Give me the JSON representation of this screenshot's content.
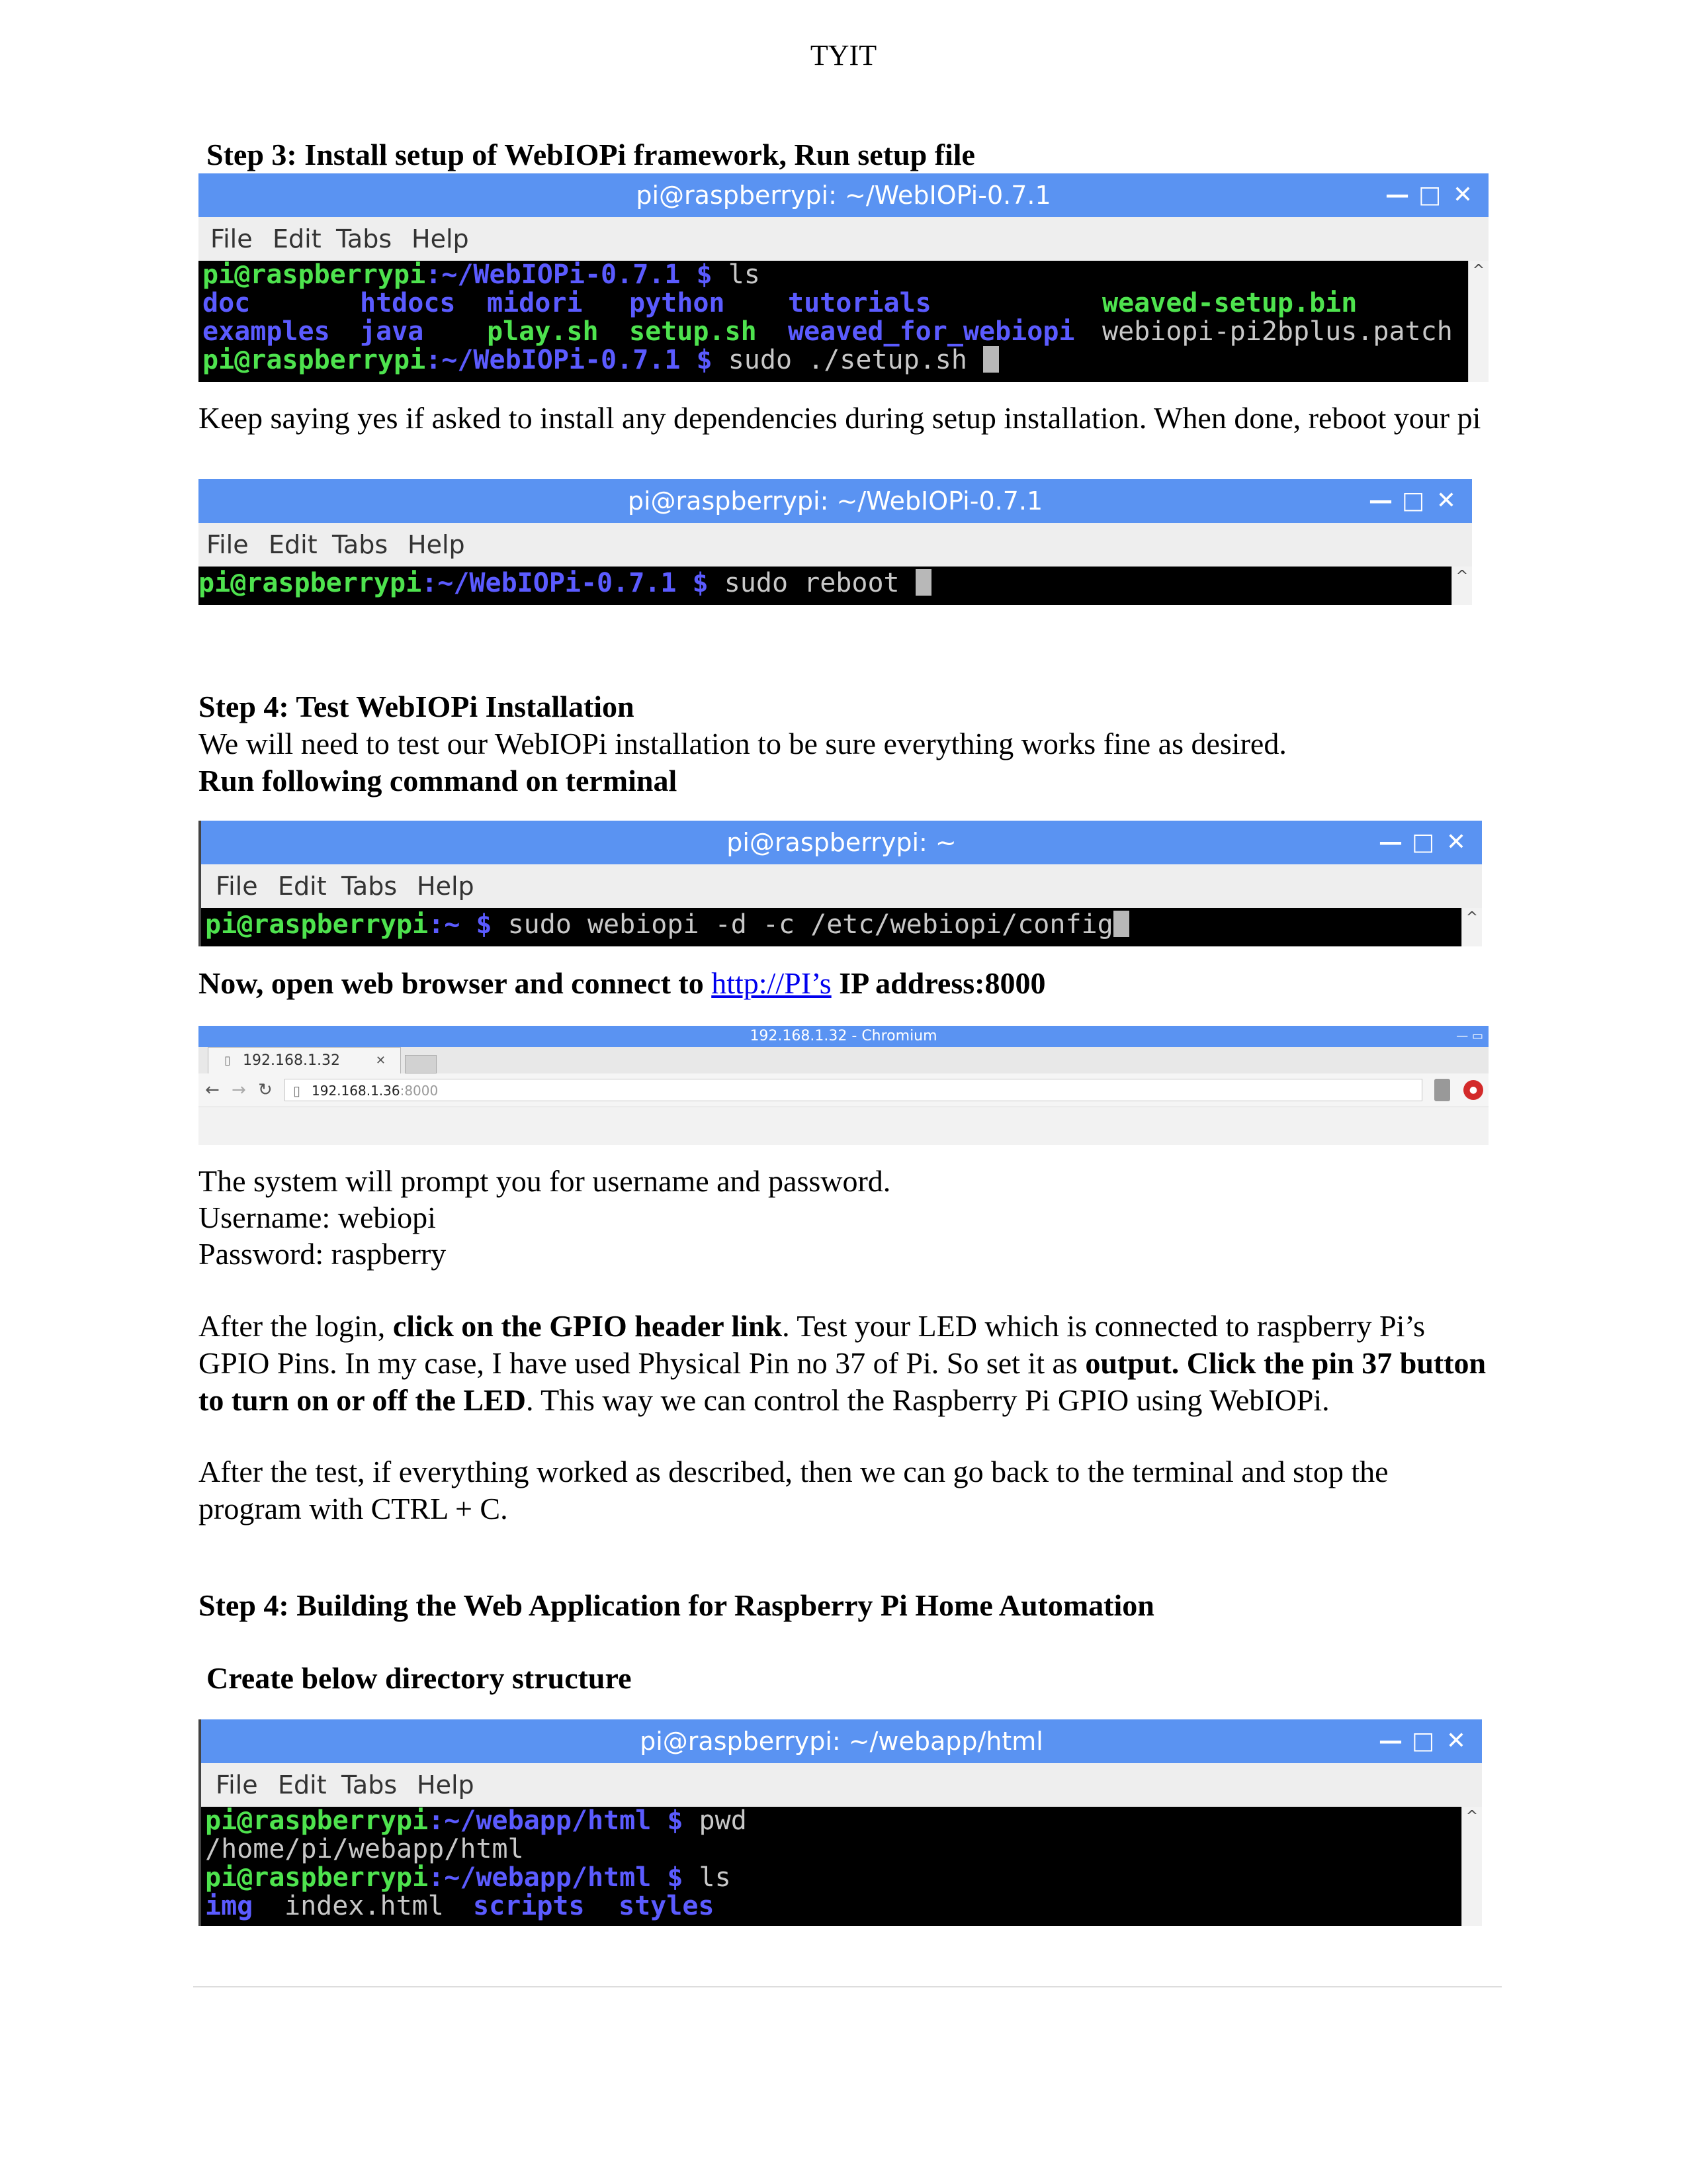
{
  "header": "TYIT",
  "step3": {
    "heading": "Step 3: Install setup of WebIOPi framework, Run setup file",
    "terminal": {
      "title": "pi@raspberrypi: ~/WebIOPi-0.7.1",
      "menu": [
        "File",
        "Edit",
        "Tabs",
        "Help"
      ],
      "prompt_user": "pi@raspberrypi",
      "prompt_path": ":~/WebIOPi-0.7.1 $",
      "cmd1": " ls",
      "ls_row1": [
        "doc",
        "htdocs",
        "midori",
        "python",
        "tutorials",
        "weaved-setup.bin"
      ],
      "ls_row2": [
        "examples",
        "java",
        "play.sh",
        "setup.sh",
        "weaved_for_webiopi",
        "webiopi-pi2bplus.patch"
      ],
      "cmd2": " sudo ./setup.sh "
    },
    "note": "Keep saying yes if asked to install any dependencies during setup installation. When done, reboot your pi",
    "terminal2": {
      "title": "pi@raspberrypi: ~/WebIOPi-0.7.1",
      "prompt_user": "pi@raspberrypi",
      "prompt_path": ":~/WebIOPi-0.7.1 $",
      "cmd": " sudo reboot "
    }
  },
  "step4": {
    "heading": "Step 4: Test WebIOPi Installation",
    "intro": "We will need to test our WebIOPi installation to be sure everything works fine as desired.",
    "run_label": "Run following command on terminal",
    "terminal": {
      "title": "pi@raspberrypi: ~",
      "prompt_user": "pi@raspberrypi",
      "prompt_path": ":~ $",
      "cmd": " sudo webiopi -d -c /etc/webiopi/config"
    },
    "browser_label_pre": "Now, open web browser and connect to ",
    "browser_label_link": "http://PI’s",
    "browser_label_post": " IP address:8000",
    "browser": {
      "title": "192.168.1.32 - Chromium",
      "tab": "192.168.1.32",
      "url": "192.168.1.36",
      "port": ":8000"
    },
    "prompt_text": "The system will prompt you for username and password.",
    "username": "Username: webiopi",
    "password": "Password: raspberry",
    "para1": {
      "a": "After the login, ",
      "b": "click on the GPIO header link",
      "c": ". Test your LED which is connected to raspberry Pi’s GPIO Pins. In my case, I have used Physical Pin no 37 of Pi. So set it as ",
      "d": "output. Click the pin 37 button to turn on or off the LED",
      "e": ". This way we can control the Raspberry Pi GPIO using WebIOPi."
    },
    "para2": "After the test, if everything worked as described, then we can go back to the terminal and stop the program with CTRL + C."
  },
  "step4b": {
    "heading": "Step 4: Building the Web Application for Raspberry Pi Home Automation",
    "subheading": "Create below directory structure",
    "terminal": {
      "title": "pi@raspberrypi: ~/webapp/html",
      "prompt_user": "pi@raspberrypi",
      "prompt_path": ":~/webapp/html $",
      "cmd1": " pwd",
      "out1": "/home/pi/webapp/html",
      "cmd2": " ls",
      "ls": [
        "img",
        "index.html",
        "scripts",
        "styles"
      ]
    }
  }
}
